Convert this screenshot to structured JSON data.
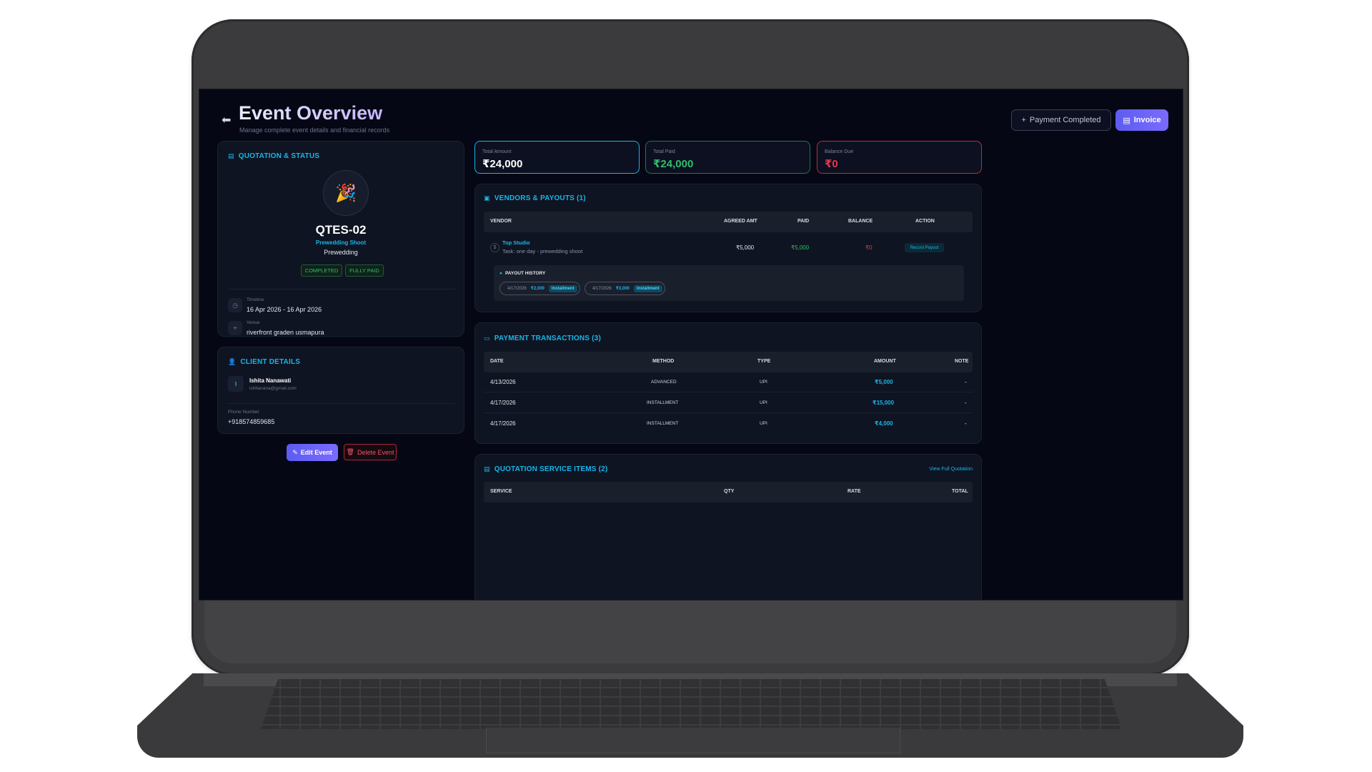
{
  "header": {
    "title": "Event Overview",
    "subtitle": "Manage complete event details and financial records",
    "payment_completed_label": "Payment Completed",
    "invoice_label": "Invoice"
  },
  "quotation": {
    "section_title": "QUOTATION & STATUS",
    "code": "QTES-02",
    "event_type": "Prewedding Shoot",
    "category": "Prewedding",
    "status_badge": "COMPLETED",
    "payment_badge": "FULLY PAID",
    "timeline_label": "Timeline",
    "timeline_value": "16 Apr 2026 - 16 Apr 2026",
    "venue_label": "Venue",
    "venue_value": "riverfront graden usmapura"
  },
  "client": {
    "section_title": "CLIENT DETAILS",
    "avatar_initial": "I",
    "name": "Ishita Nanawati",
    "email": "ishitanana@gmail.com",
    "phone_label": "Phone Number",
    "phone_value": "+918574859685"
  },
  "actions": {
    "edit_label": "Edit Event",
    "delete_label": "Delete Event"
  },
  "stats": {
    "total_amount_label": "Total Amount",
    "total_amount_value": "₹24,000",
    "total_paid_label": "Total Paid",
    "total_paid_value": "₹24,000",
    "balance_due_label": "Balance Due",
    "balance_due_value": "₹0",
    "colors": {
      "amount": "#18b6e8",
      "paid": "#2fbf6a",
      "due": "#e5384a"
    }
  },
  "vendors": {
    "section_title": "VENDORS & PAYOUTS (1)",
    "columns": [
      "VENDOR",
      "AGREED AMT",
      "PAID",
      "BALANCE",
      "ACTION"
    ],
    "row": {
      "name": "Top Studio",
      "task": "Task: one day - prewedding shoot",
      "agreed": "₹5,000",
      "paid": "₹5,000",
      "balance": "₹0",
      "action": "Record Payout"
    },
    "payout_history_title": "PAYOUT HISTORY",
    "payouts": [
      {
        "date": "4/17/2026",
        "amount": "₹2,000",
        "tag": "Installment"
      },
      {
        "date": "4/17/2026",
        "amount": "₹3,000",
        "tag": "Installment"
      }
    ]
  },
  "transactions": {
    "section_title": "PAYMENT TRANSACTIONS (3)",
    "columns": [
      "DATE",
      "METHOD",
      "TYPE",
      "AMOUNT",
      "NOTE"
    ],
    "rows": [
      {
        "date": "4/13/2026",
        "method": "ADVANCED",
        "type": "UPI",
        "amount": "₹5,000",
        "note": "-"
      },
      {
        "date": "4/17/2026",
        "method": "INSTALLMENT",
        "type": "UPI",
        "amount": "₹15,000",
        "note": "-"
      },
      {
        "date": "4/17/2026",
        "method": "INSTALLMENT",
        "type": "UPI",
        "amount": "₹4,000",
        "note": "-"
      }
    ]
  },
  "services": {
    "section_title": "QUOTATION SERVICE ITEMS (2)",
    "view_full_label": "View Full Quotation",
    "columns": [
      "SERVICE",
      "QTY",
      "RATE",
      "TOTAL"
    ]
  }
}
